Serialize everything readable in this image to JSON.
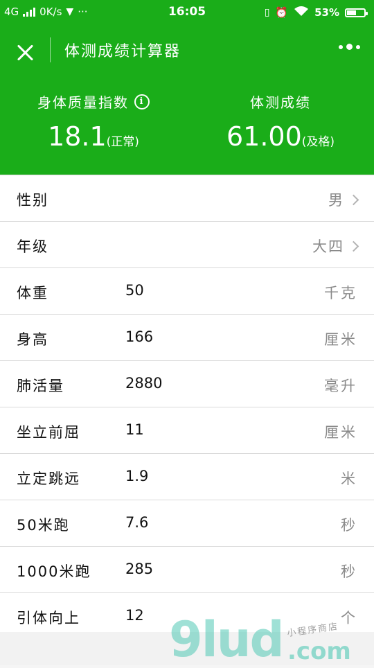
{
  "status_bar": {
    "network": "4G",
    "speed": "0K/s",
    "more": "···",
    "time": "16:05",
    "battery_percent": "53%",
    "battery_level": 0.53
  },
  "header": {
    "title": "体测成绩计算器",
    "bmi": {
      "label": "身体质量指数",
      "info_glyph": "i",
      "value": "18.1",
      "status": "(正常)"
    },
    "score": {
      "label": "体测成绩",
      "value": "61.00",
      "status": "(及格)"
    }
  },
  "form": {
    "gender": {
      "label": "性别",
      "value": "男"
    },
    "grade": {
      "label": "年级",
      "value": "大四"
    },
    "weight": {
      "label": "体重",
      "value": "50",
      "unit": "千克"
    },
    "height": {
      "label": "身高",
      "value": "166",
      "unit": "厘米"
    },
    "vital_capacity": {
      "label": "肺活量",
      "value": "2880",
      "unit": "毫升"
    },
    "sit_reach": {
      "label": "坐立前屈",
      "value": "11",
      "unit": "厘米"
    },
    "long_jump": {
      "label": "立定跳远",
      "value": "1.9",
      "unit": "米"
    },
    "run_50": {
      "label": "50米跑",
      "value": "7.6",
      "unit": "秒"
    },
    "run_1000": {
      "label": "1000米跑",
      "value": "285",
      "unit": "秒"
    },
    "pull_up": {
      "label": "引体向上",
      "value": "12",
      "unit": "个"
    }
  },
  "watermark": {
    "main": "9lud",
    "small": "小程序商店",
    "domain": ".com"
  },
  "colors": {
    "brand_green": "#1aad19",
    "unit_gray": "#8a8a8a"
  }
}
